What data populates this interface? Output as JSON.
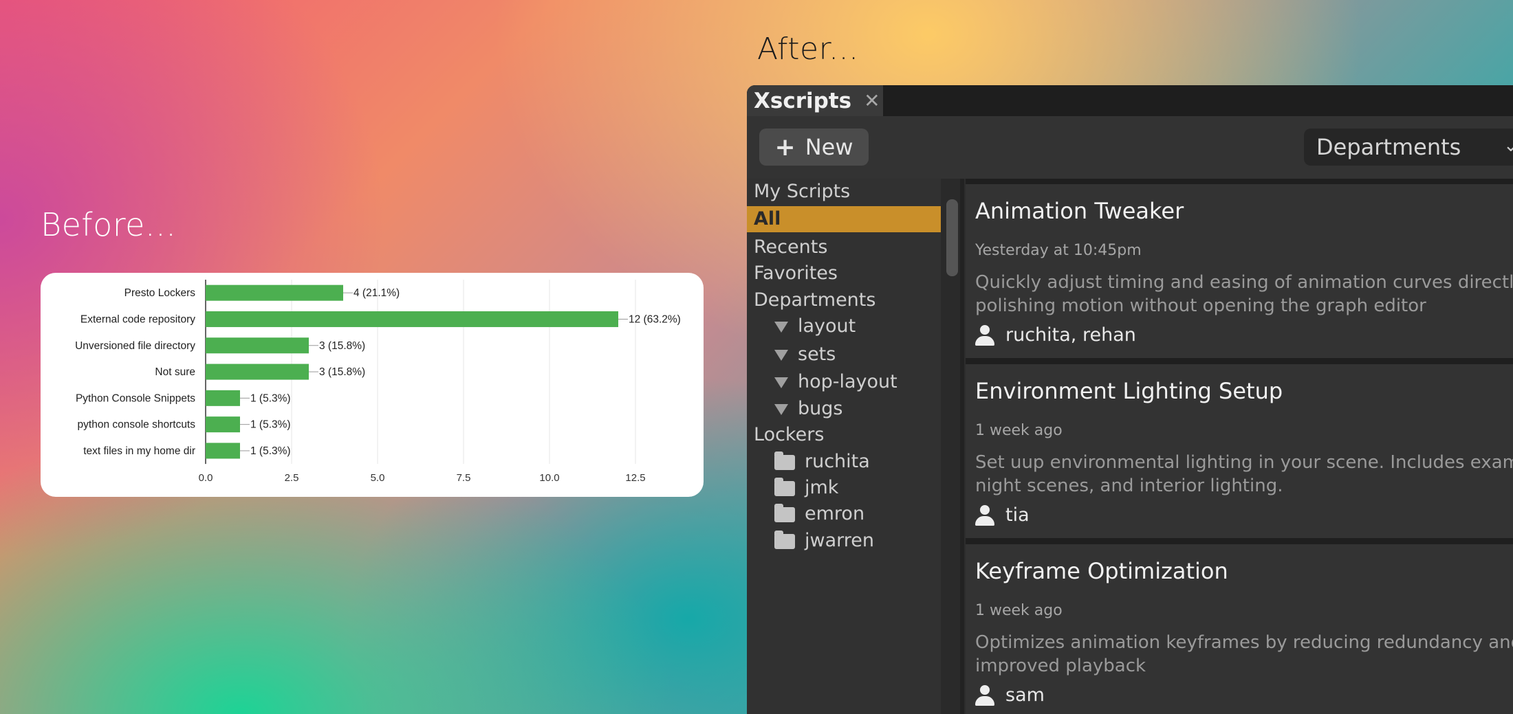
{
  "headings": {
    "before": "Before...",
    "after": "After..."
  },
  "chart_data": {
    "type": "bar",
    "orientation": "horizontal",
    "categories": [
      "Presto Lockers",
      "External code repository",
      "Unversioned file directory",
      "Not sure",
      "Python Console Snippets",
      "python console shortcuts",
      "text files in my home dir"
    ],
    "values": [
      4,
      12,
      3,
      3,
      1,
      1,
      1
    ],
    "value_labels": [
      "4 (21.1%)",
      "12 (63.2%)",
      "3 (15.8%)",
      "3 (15.8%)",
      "1 (5.3%)",
      "1 (5.3%)",
      "1 (5.3%)"
    ],
    "xticks": [
      "0.0",
      "2.5",
      "5.0",
      "7.5",
      "10.0",
      "12.5"
    ],
    "xlim": [
      0,
      12.5
    ],
    "grid": true,
    "bar_color": "#4caf50"
  },
  "app": {
    "tab_title": "Xscripts",
    "tab_close": "✕",
    "new_button": {
      "icon": "plus-icon",
      "label": "New"
    },
    "department_select": {
      "value": "Departments"
    },
    "sidebar": {
      "my_scripts": "My Scripts",
      "all": "All",
      "recents": "Recents",
      "favorites": "Favorites",
      "departments": "Departments",
      "department_items": [
        "layout",
        "sets",
        "hop-layout",
        "bugs"
      ],
      "lockers": "Lockers",
      "locker_items": [
        "ruchita",
        "jmk",
        "emron",
        "jwarren"
      ]
    },
    "selected_color": "#c98f2a",
    "cards": [
      {
        "title": "Animation Tweaker",
        "time": "Yesterday at 10:45pm",
        "desc_line1": "Quickly adjust timing and easing of animation curves directly",
        "desc_line2": "polishing motion without opening the graph editor",
        "owners": "ruchita, rehan"
      },
      {
        "title": "Environment Lighting Setup",
        "time": "1 week ago",
        "desc_line1": "Set uup environmental lighting in your scene. Includes examp",
        "desc_line2": "night scenes, and interior lighting.",
        "owners": "tia"
      },
      {
        "title": "Keyframe Optimization",
        "time": "1 week ago",
        "desc_line1": "Optimizes animation keyframes by reducing redundancy and",
        "desc_line2": "improved playback",
        "owners": "sam"
      }
    ]
  }
}
